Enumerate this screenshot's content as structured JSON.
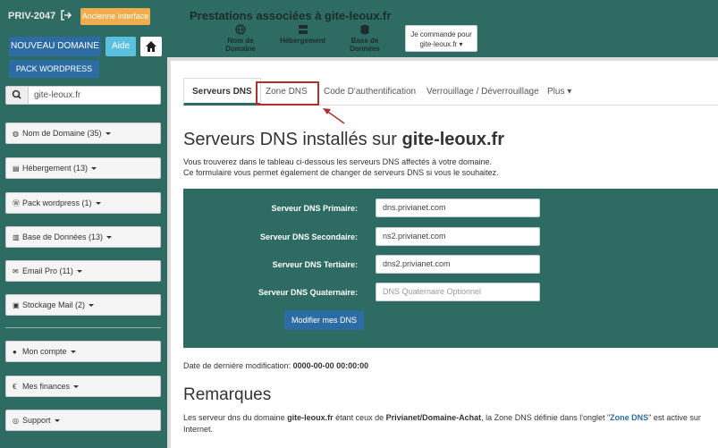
{
  "header": {
    "brand": "PRIV-2047",
    "old_ui": "Ancienne interface",
    "title": "Prestations associées à gite-leoux.fr",
    "quick_links": [
      "Nom de Domaine",
      "Hébergement",
      "Base de Données"
    ],
    "cmd_line1": "Je commande pour",
    "cmd_line2": "gite-leoux.fr ▾"
  },
  "sidebar": {
    "new_domain": "NOUVEAU DOMAINE",
    "help": "Aide",
    "pack_wp": "PACK WORDPRESS",
    "search_value": "gite-leoux.fr",
    "menus": [
      {
        "icon": "globe-icon",
        "label": "Nom de Domaine (35)"
      },
      {
        "icon": "server-icon",
        "label": "Hébergement (13)"
      },
      {
        "icon": "wordpress-icon",
        "label": "Pack wordpress (1)"
      },
      {
        "icon": "database-icon",
        "label": "Base de Données (13)"
      },
      {
        "icon": "envelope-icon",
        "label": "Email Pro (11)"
      },
      {
        "icon": "archive-icon",
        "label": "Stockage Mail (2)"
      },
      {
        "icon": "user-icon",
        "label": "Mon compte"
      },
      {
        "icon": "euro-icon",
        "label": "Mes finances"
      },
      {
        "icon": "support-icon",
        "label": "Support"
      }
    ]
  },
  "tabs": [
    "Serveurs DNS",
    "Zone DNS",
    "Code D'authentification",
    "Verrouillage / Déverrouillage",
    "Plus ▾"
  ],
  "main": {
    "heading_prefix": "Serveurs DNS installés sur ",
    "heading_domain": "gite-leoux.fr",
    "intro_1": "Vous trouverez dans le tableau ci-dessous les serveurs DNS affectés à votre domaine.",
    "intro_2": "Ce formulaire vous permet également de changer de serveurs DNS si vous le souhaitez.",
    "fields": [
      {
        "label": "Serveur DNS Primaire:",
        "value": "dns.privianet.com",
        "placeholder": ""
      },
      {
        "label": "Serveur DNS Secondaire:",
        "value": "ns2.privianet.com",
        "placeholder": ""
      },
      {
        "label": "Serveur DNS Tertiaire:",
        "value": "dns2.privianet.com",
        "placeholder": ""
      },
      {
        "label": "Serveur DNS Quaternaire:",
        "value": "",
        "placeholder": "DNS Quaternaire Optionnel"
      }
    ],
    "submit": "Modifier mes DNS",
    "date_label": "Date de dernière modification: ",
    "date_value": "0000-00-00 00:00:00",
    "remarks_title": "Remarques",
    "rem_a": "Les serveur dns du domaine ",
    "rem_domain": "gite-leoux.fr",
    "rem_b": " étant ceux de ",
    "rem_provider": "Privianet/Domaine-Achat",
    "rem_c": ", la Zone DNS définie dans l'onglet \"",
    "rem_link": "Zone DNS",
    "rem_d": "\" est active sur Internet."
  },
  "colors": {
    "teal": "#2e6b63",
    "primary": "#2d6ca2",
    "info": "#5bc0de",
    "warning": "#f0ad4e",
    "highlight": "#b03030"
  }
}
